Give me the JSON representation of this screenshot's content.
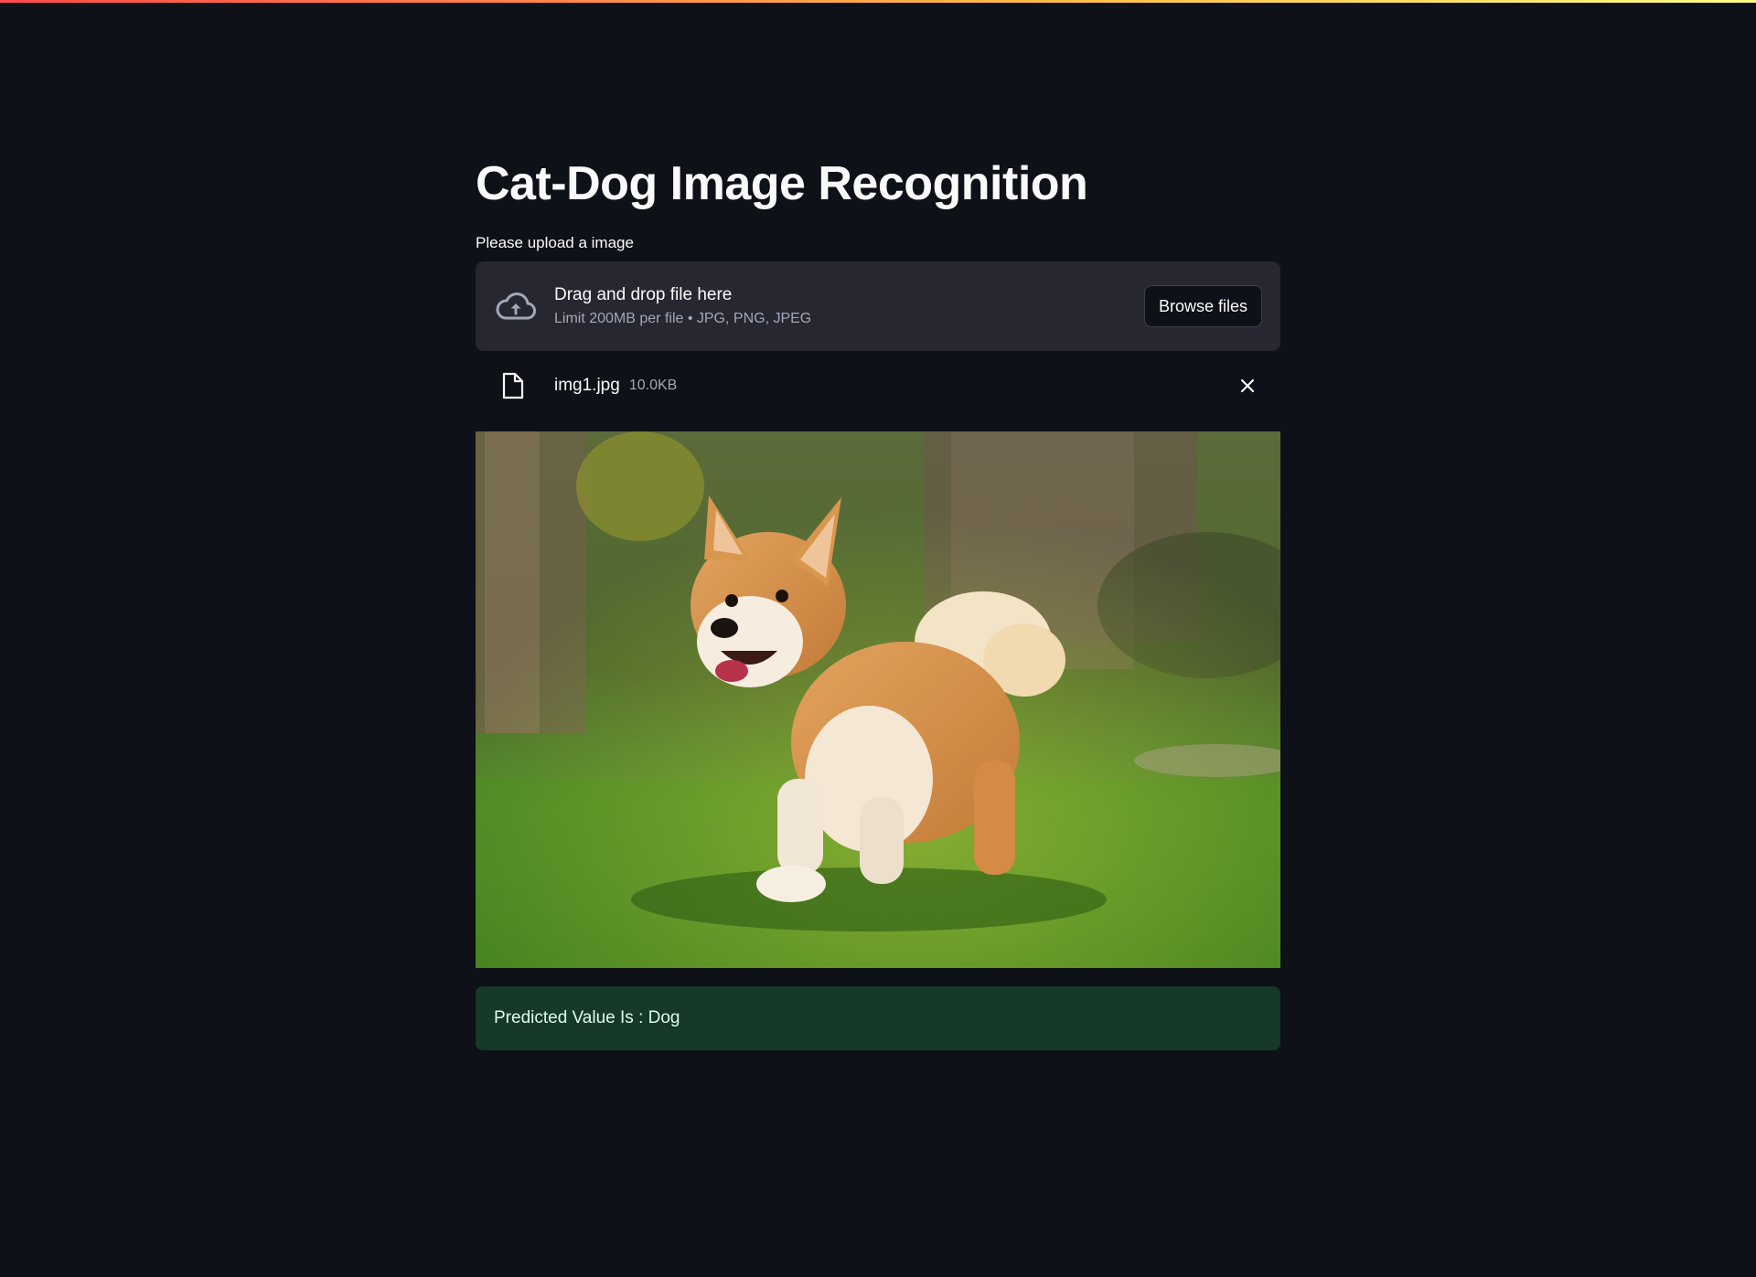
{
  "page": {
    "title": "Cat-Dog Image Recognition"
  },
  "uploader": {
    "label": "Please upload a image",
    "instruction": "Drag and drop file here",
    "limit": "Limit 200MB per file • JPG, PNG, JPEG",
    "browse_label": "Browse files",
    "upload_icon": "cloud-upload-icon"
  },
  "uploaded_file": {
    "name": "img1.jpg",
    "size": "10.0KB",
    "file_icon": "file-icon",
    "remove_icon": "close-icon"
  },
  "image": {
    "subject": "corgi running on grass"
  },
  "result": {
    "text": "Predicted Value Is : Dog",
    "background_color": "#173928",
    "text_color": "#dffde9"
  },
  "colors": {
    "background": "#0e1117",
    "dropzone": "#262730",
    "accent_gradient_start": "#ff4b4b",
    "accent_gradient_end": "#fffd80"
  }
}
